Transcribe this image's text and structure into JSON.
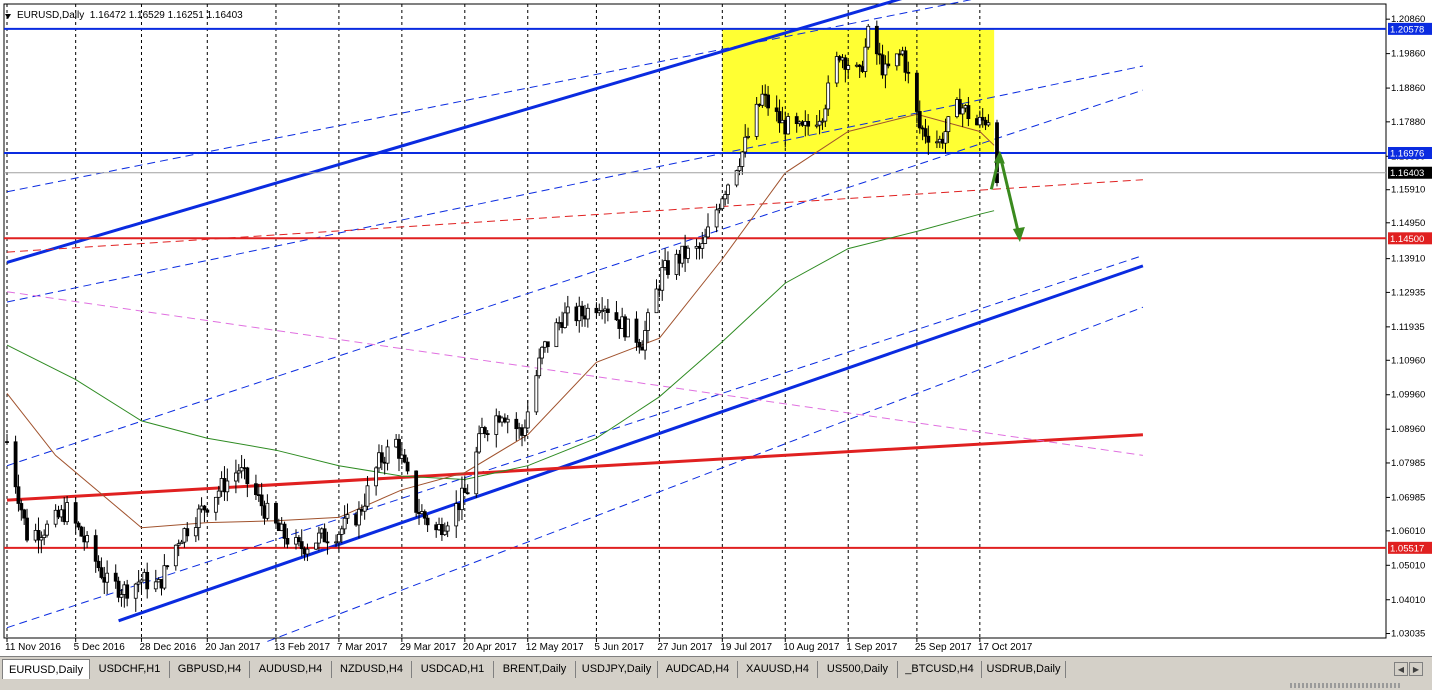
{
  "header": {
    "symbol": "EURUSD",
    "timeframe": "Daily",
    "text": "EURUSD,Daily  1.16472 1.16529 1.16251 1.16403"
  },
  "colors": {
    "background": "#ffffff",
    "grid": "#000000",
    "trend_line": "#0a2be0",
    "horizontal_support": "#e02020",
    "horizontal_resistance": "#0a2be0",
    "highlight_box": "#ffff33",
    "ma_fast": "#a0522d",
    "ma_slow": "#2e8b22",
    "arrow": "#3a8a1e",
    "pink_line": "#e070e0",
    "candle": "#000000"
  },
  "chart_data": {
    "type": "candlestick",
    "symbol": "EURUSD",
    "timeframe": "Daily",
    "ohlc_last": {
      "open": 1.16472,
      "high": 1.16529,
      "low": 1.16251,
      "close": 1.16403
    },
    "ylim": [
      1.029,
      1.213
    ],
    "y_ticks": [
      1.2086,
      1.1986,
      1.1886,
      1.1788,
      1.1688,
      1.1591,
      1.1495,
      1.1391,
      1.1293,
      1.1193,
      1.1096,
      1.0996,
      1.0896,
      1.0798,
      1.0698,
      1.0601,
      1.0501,
      1.0401,
      1.0303
    ],
    "y_tick_labels": [
      "1.20860",
      "1.19860",
      "1.18860",
      "1.17880",
      "1.16880",
      "1.15910",
      "1.14950",
      "1.13910",
      "1.12935",
      "1.11935",
      "1.10960",
      "1.09960",
      "1.08960",
      "1.07985",
      "1.06985",
      "1.06010",
      "1.05010",
      "1.04010",
      "1.03035"
    ],
    "x_dates": [
      "11 Nov 2016",
      "5 Dec 2016",
      "28 Dec 2016",
      "20 Jan 2017",
      "13 Feb 2017",
      "7 Mar 2017",
      "29 Mar 2017",
      "20 Apr 2017",
      "12 May 2017",
      "5 Jun 2017",
      "27 Jun 2017",
      "19 Jul 2017",
      "10 Aug 2017",
      "1 Sep 2017",
      "25 Sep 2017",
      "17 Oct 2017"
    ],
    "price_labels": [
      {
        "value": 1.20578,
        "text": "1.20578",
        "color": "#0a2be0"
      },
      {
        "value": 1.16976,
        "text": "1.16976",
        "color": "#0a2be0"
      },
      {
        "value": 1.16403,
        "text": "1.16403",
        "color": "#000000"
      },
      {
        "value": 1.145,
        "text": "1.14500",
        "color": "#e02020"
      },
      {
        "value": 1.05517,
        "text": "1.05517",
        "color": "#e02020"
      }
    ],
    "horizontal_levels": [
      {
        "value": 1.20578,
        "color": "#0a2be0"
      },
      {
        "value": 1.16976,
        "color": "#0a2be0"
      },
      {
        "value": 1.145,
        "color": "#e02020"
      },
      {
        "value": 1.05517,
        "color": "#e02020"
      }
    ],
    "highlight_zone": {
      "from": "19 Jul 2017",
      "to": "22 Oct 2017",
      "top": 1.2058,
      "bottom": 1.1698
    },
    "forecast_arrow": {
      "points": [
        [
          "21 Oct 2017",
          1.1592
        ],
        [
          "24 Oct 2017",
          1.1693
        ],
        [
          "31 Oct 2017",
          1.1448
        ]
      ]
    },
    "trend_lines": [
      {
        "style": "thick",
        "color": "#0a2be0",
        "from": [
          "11 Nov 2016",
          1.138
        ],
        "to": [
          "20 Oct 2017",
          1.222
        ]
      },
      {
        "style": "thick",
        "color": "#0a2be0",
        "from": [
          "20 Dec 2016",
          1.034
        ],
        "to": [
          "13 Dec 2017",
          1.137
        ]
      },
      {
        "style": "dashed",
        "color": "#0a2be0",
        "from": [
          "11 Nov 2016",
          1.1265
        ],
        "to": [
          "13 Dec 2017",
          1.195
        ]
      },
      {
        "style": "dashed",
        "color": "#0a2be0",
        "from": [
          "11 Nov 2016",
          1.079
        ],
        "to": [
          "13 Dec 2017",
          1.188
        ]
      },
      {
        "style": "dashed",
        "color": "#0a2be0",
        "from": [
          "11 Nov 2016",
          1.1585
        ],
        "to": [
          "4 Dec 2017",
          1.2227
        ]
      },
      {
        "style": "dashed",
        "color": "#0a2be0",
        "from": [
          "11 Nov 2016",
          1.032
        ],
        "to": [
          "13 Dec 2017",
          1.14
        ]
      },
      {
        "style": "dashed",
        "color": "#0a2be0",
        "from": [
          "10 Feb 2017",
          1.028
        ],
        "to": [
          "13 Dec 2017",
          1.125
        ]
      },
      {
        "style": "thick",
        "color": "#e02020",
        "from": [
          "11 Nov 2016",
          1.069
        ],
        "to": [
          "13 Dec 2017",
          1.088
        ]
      },
      {
        "style": "dashed",
        "color": "#e02020",
        "from": [
          "11 Nov 2016",
          1.141
        ],
        "to": [
          "13 Dec 2017",
          1.162
        ]
      },
      {
        "style": "dashed",
        "color": "#e070e0",
        "from": [
          "11 Nov 2016",
          1.1295
        ],
        "to": [
          "13 Dec 2017",
          1.082
        ]
      }
    ],
    "ma_fast_points": [
      [
        "11 Nov 2016",
        1.1
      ],
      [
        "28 Nov 2016",
        1.082
      ],
      [
        "28 Dec 2016",
        1.061
      ],
      [
        "20 Jan 2017",
        1.0625
      ],
      [
        "13 Feb 2017",
        1.063
      ],
      [
        "7 Mar 2017",
        1.064
      ],
      [
        "29 Mar 2017",
        1.072
      ],
      [
        "20 Apr 2017",
        1.077
      ],
      [
        "12 May 2017",
        1.088
      ],
      [
        "5 Jun 2017",
        1.109
      ],
      [
        "27 Jun 2017",
        1.116
      ],
      [
        "19 Jul 2017",
        1.139
      ],
      [
        "10 Aug 2017",
        1.164
      ],
      [
        "1 Sep 2017",
        1.176
      ],
      [
        "25 Sep 2017",
        1.181
      ],
      [
        "17 Oct 2017",
        1.176
      ],
      [
        "22 Oct 2017",
        1.172
      ]
    ],
    "ma_slow_points": [
      [
        "11 Nov 2016",
        1.114
      ],
      [
        "5 Dec 2016",
        1.104
      ],
      [
        "28 Dec 2016",
        1.092
      ],
      [
        "20 Jan 2017",
        1.087
      ],
      [
        "13 Feb 2017",
        1.0835
      ],
      [
        "7 Mar 2017",
        1.079
      ],
      [
        "29 Mar 2017",
        1.076
      ],
      [
        "20 Apr 2017",
        1.075
      ],
      [
        "12 May 2017",
        1.079
      ],
      [
        "5 Jun 2017",
        1.087
      ],
      [
        "27 Jun 2017",
        1.099
      ],
      [
        "19 Jul 2017",
        1.115
      ],
      [
        "10 Aug 2017",
        1.132
      ],
      [
        "1 Sep 2017",
        1.142
      ],
      [
        "25 Sep 2017",
        1.147
      ],
      [
        "17 Oct 2017",
        1.152
      ],
      [
        "22 Oct 2017",
        1.153
      ]
    ],
    "close_path": [
      [
        "11 Nov 2016",
        1.086
      ],
      [
        "18 Nov 2016",
        1.059
      ],
      [
        "25 Nov 2016",
        1.061
      ],
      [
        "2 Dec 2016",
        1.066
      ],
      [
        "9 Dec 2016",
        1.056
      ],
      [
        "16 Dec 2016",
        1.045
      ],
      [
        "22 Dec 2016",
        1.043
      ],
      [
        "28 Dec 2016",
        1.046
      ],
      [
        "3 Jan 2017",
        1.044
      ],
      [
        "10 Jan 2017",
        1.058
      ],
      [
        "17 Jan 2017",
        1.065
      ],
      [
        "24 Jan 2017",
        1.072
      ],
      [
        "31 Jan 2017",
        1.078
      ],
      [
        "7 Feb 2017",
        1.069
      ],
      [
        "14 Feb 2017",
        1.06
      ],
      [
        "21 Feb 2017",
        1.055
      ],
      [
        "28 Feb 2017",
        1.058
      ],
      [
        "7 Mar 2017",
        1.06
      ],
      [
        "14 Mar 2017",
        1.065
      ],
      [
        "21 Mar 2017",
        1.08
      ],
      [
        "27 Mar 2017",
        1.086
      ],
      [
        "3 Apr 2017",
        1.067
      ],
      [
        "10 Apr 2017",
        1.06
      ],
      [
        "17 Apr 2017",
        1.067
      ],
      [
        "21 Apr 2017",
        1.072
      ],
      [
        "26 Apr 2017",
        1.089
      ],
      [
        "3 May 2017",
        1.095
      ],
      [
        "10 May 2017",
        1.088
      ],
      [
        "17 May 2017",
        1.112
      ],
      [
        "24 May 2017",
        1.122
      ],
      [
        "31 May 2017",
        1.123
      ],
      [
        "7 Jun 2017",
        1.127
      ],
      [
        "14 Jun 2017",
        1.12
      ],
      [
        "21 Jun 2017",
        1.115
      ],
      [
        "28 Jun 2017",
        1.135
      ],
      [
        "5 Jul 2017",
        1.14
      ],
      [
        "12 Jul 2017",
        1.142
      ],
      [
        "19 Jul 2017",
        1.158
      ],
      [
        "26 Jul 2017",
        1.17
      ],
      [
        "2 Aug 2017",
        1.186
      ],
      [
        "9 Aug 2017",
        1.178
      ],
      [
        "16 Aug 2017",
        1.176
      ],
      [
        "23 Aug 2017",
        1.182
      ],
      [
        "29 Aug 2017",
        1.199
      ],
      [
        "5 Sep 2017",
        1.192
      ],
      [
        "8 Sep 2017",
        1.204
      ],
      [
        "14 Sep 2017",
        1.193
      ],
      [
        "20 Sep 2017",
        1.199
      ],
      [
        "26 Sep 2017",
        1.177
      ],
      [
        "3 Oct 2017",
        1.173
      ],
      [
        "10 Oct 2017",
        1.184
      ],
      [
        "16 Oct 2017",
        1.178
      ],
      [
        "20 Oct 2017",
        1.18
      ],
      [
        "23 Oct 2017",
        1.164
      ]
    ]
  },
  "tabs": [
    {
      "label": "EURUSD,Daily",
      "active": true
    },
    {
      "label": "USDCHF,H1",
      "active": false
    },
    {
      "label": "GBPUSD,H4",
      "active": false
    },
    {
      "label": "AUDUSD,H4",
      "active": false
    },
    {
      "label": "NZDUSD,H4",
      "active": false
    },
    {
      "label": "USDCAD,H1",
      "active": false
    },
    {
      "label": "BRENT,Daily",
      "active": false
    },
    {
      "label": "USDJPY,Daily",
      "active": false
    },
    {
      "label": "AUDCAD,H4",
      "active": false
    },
    {
      "label": "XAUUSD,H4",
      "active": false
    },
    {
      "label": "US500,Daily",
      "active": false
    },
    {
      "label": "_BTCUSD,H4",
      "active": false
    },
    {
      "label": "USDRUB,Daily",
      "active": false
    }
  ],
  "tab_scroll": {
    "left_icon": "◀",
    "right_icon": "▶"
  }
}
